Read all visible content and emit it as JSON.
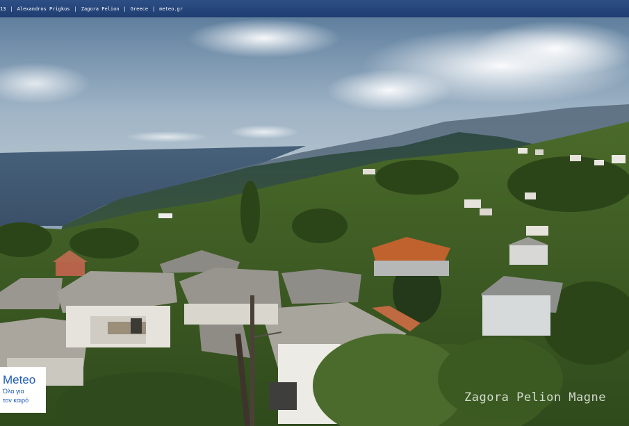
{
  "top_bar": {
    "items": [
      "13",
      "Alexandros Prigkos",
      "Zagora Pelion",
      "Greece",
      "meteo.gr"
    ]
  },
  "brand": {
    "name": "Meteo",
    "tagline_line1": "Όλα για",
    "tagline_line2": "τον καιρό"
  },
  "watermark": "Zagora Pelion Magne",
  "colors": {
    "bar_blue": "#2d4f86",
    "brand_blue": "#1f5bb5"
  }
}
